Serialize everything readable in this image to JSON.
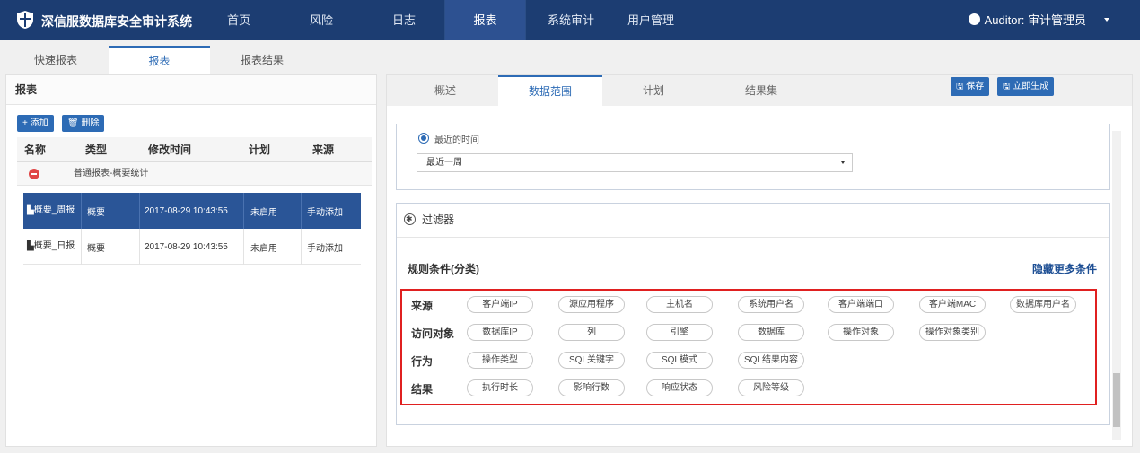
{
  "header": {
    "brand": "深信服数据库安全审计系统",
    "nav": [
      "首页",
      "风险",
      "日志",
      "报表",
      "系统审计",
      "用户管理"
    ],
    "active_nav": "报表",
    "user": "Auditor: 审计管理员"
  },
  "top_tabs": [
    "快速报表",
    "报表",
    "报表结果"
  ],
  "left": {
    "title": "报表",
    "add_label": "+ 添加",
    "delete_label": "🗑 删除",
    "columns": [
      "名称",
      "类型",
      "修改时间",
      "计划",
      "来源"
    ],
    "group_label": "普通报表-概要统计",
    "rows": [
      {
        "name": "概要_周报",
        "type": "概要",
        "time": "2017-08-29 10:43:55",
        "plan": "未启用",
        "source": "手动添加",
        "selected": true
      },
      {
        "name": "概要_日报",
        "type": "概要",
        "time": "2017-08-29 10:43:55",
        "plan": "未启用",
        "source": "手动添加",
        "selected": false
      }
    ]
  },
  "right": {
    "tabs": [
      "概述",
      "数据范围",
      "计划",
      "结果集"
    ],
    "active_tab": "数据范围",
    "save_label": "🖫 保存",
    "generate_label": "🖫 立即生成",
    "time_radio_label": "最近的时间",
    "time_select_value": "最近一周",
    "filter_title": "过滤器",
    "rule_title": "规则条件(分类)",
    "hide_more": "隐藏更多条件",
    "rules": [
      {
        "label": "来源",
        "chips": [
          "客户端IP",
          "源应用程序",
          "主机名",
          "系统用户名",
          "客户端端口",
          "客户端MAC",
          "数据库用户名"
        ]
      },
      {
        "label": "访问对象",
        "chips": [
          "数据库IP",
          "列",
          "引擎",
          "数据库",
          "操作对象",
          "操作对象类别"
        ]
      },
      {
        "label": "行为",
        "chips": [
          "操作类型",
          "SQL关键字",
          "SQL模式",
          "SQL结果内容"
        ]
      },
      {
        "label": "结果",
        "chips": [
          "执行时长",
          "影响行数",
          "响应状态",
          "风险等级"
        ]
      }
    ]
  },
  "colors": {
    "topbar": "#1c3d72",
    "accent": "#2d6bb5",
    "selected_row": "#2a5597",
    "highlight_box": "#e02020"
  }
}
